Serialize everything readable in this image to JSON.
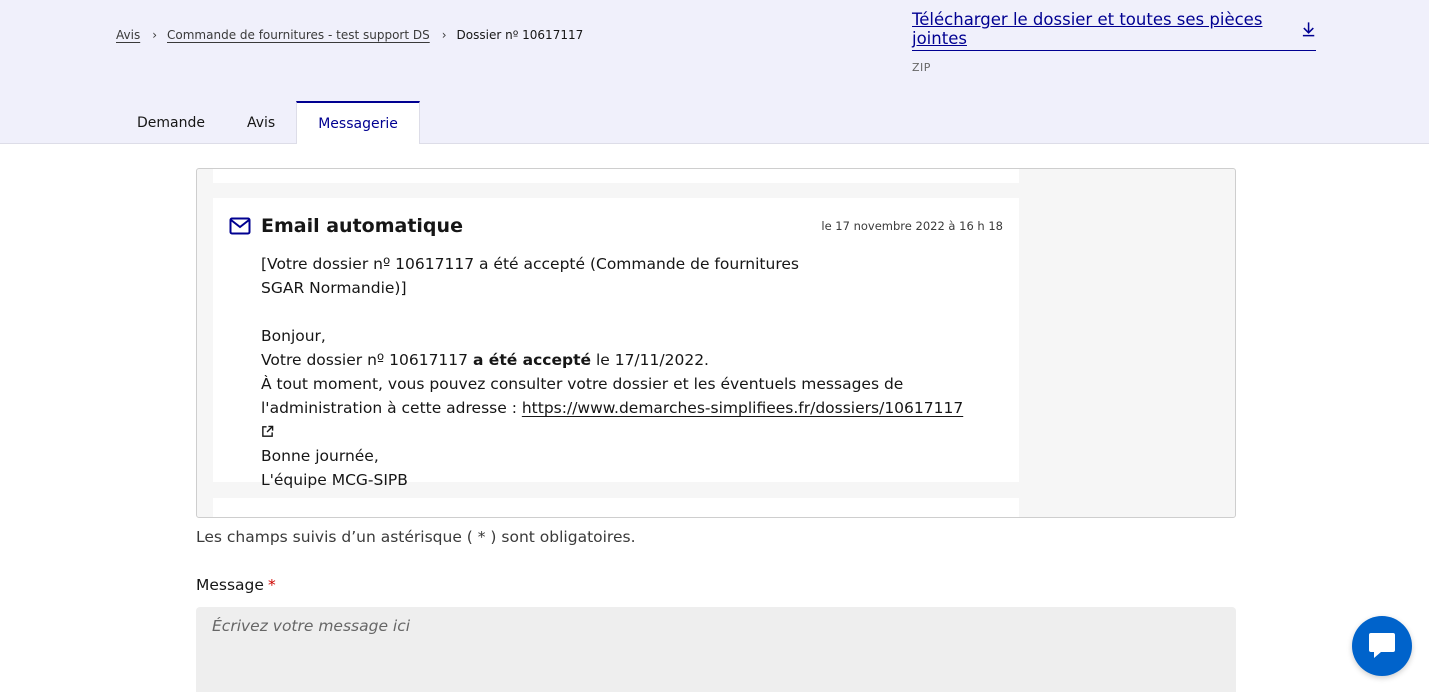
{
  "breadcrumb": {
    "items": [
      "Avis",
      "Commande de fournitures - test support DS"
    ],
    "current": "Dossier nº 10617117"
  },
  "download": {
    "label": "Télécharger le dossier et toutes ses pièces jointes",
    "format": "ZIP"
  },
  "tabs": [
    {
      "label": "Demande",
      "active": false
    },
    {
      "label": "Avis",
      "active": false
    },
    {
      "label": "Messagerie",
      "active": true
    }
  ],
  "message": {
    "icon": "mail-icon",
    "title": "Email automatique",
    "date": "le 17 novembre 2022 à 16 h 18",
    "subject_line1": "[Votre dossier nº 10617117 a été accepté (Commande de fournitures",
    "subject_line2": "SGAR Normandie)]",
    "greeting": "Bonjour,",
    "body_prefix": "Votre dossier nº 10617117 ",
    "body_bold": "a été accepté",
    "body_suffix": " le 17/11/2022.",
    "body_line3": "À tout moment, vous pouvez consulter votre dossier et les éventuels messages de",
    "body_line4_prefix": "l'administration à cette adresse : ",
    "link": "https://www.demarches-simplifiees.fr/dossiers/10617117",
    "closing": "Bonne journée,",
    "signature": "L'équipe MCG-SIPB"
  },
  "form": {
    "required_note": "Les champs suivis d’un astérisque ( * ) sont obligatoires.",
    "message_label": "Message",
    "required_star": "*",
    "placeholder": "Écrivez votre message ici"
  },
  "colors": {
    "accent": "#000091",
    "header_bg": "#f0f0fb",
    "required": "#ce0500",
    "chat_button": "#0063cb"
  }
}
